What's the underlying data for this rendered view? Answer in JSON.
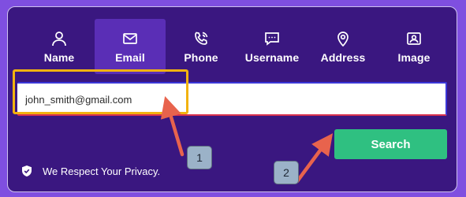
{
  "tabs": [
    {
      "label": "Name",
      "icon": "user-icon",
      "active": false
    },
    {
      "label": "Email",
      "icon": "envelope-icon",
      "active": true
    },
    {
      "label": "Phone",
      "icon": "phone-icon",
      "active": false
    },
    {
      "label": "Username",
      "icon": "chat-bubble-icon",
      "active": false
    },
    {
      "label": "Address",
      "icon": "map-pin-icon",
      "active": false
    },
    {
      "label": "Image",
      "icon": "image-icon",
      "active": false
    }
  ],
  "search": {
    "value": "john_smith@gmail.com",
    "button_label": "Search"
  },
  "privacy": {
    "text": "We Respect Your Privacy.",
    "icon": "shield-check-icon"
  },
  "annotations": [
    {
      "label": "1"
    },
    {
      "label": "2"
    }
  ],
  "colors": {
    "background": "#7f4fe0",
    "panel": "#3a1780",
    "active_tab": "#5a2eb6",
    "search_button": "#2fc081",
    "highlight": "#f2b20f",
    "arrow": "#e8634d"
  }
}
